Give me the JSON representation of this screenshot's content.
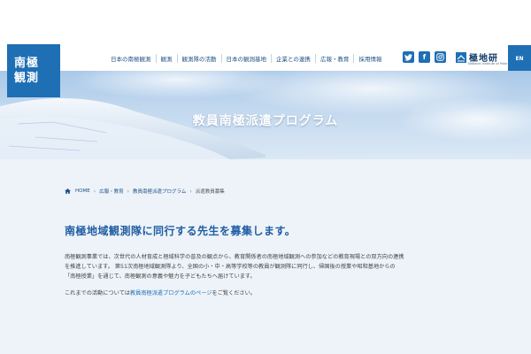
{
  "logo": {
    "line1": "南極",
    "line2": "観測"
  },
  "nav": {
    "items": [
      {
        "label": "日本の南極観測"
      },
      {
        "label": "観測"
      },
      {
        "label": "観測隊の活動"
      },
      {
        "label": "日本の観測基地"
      },
      {
        "label": "企業との連携"
      },
      {
        "label": "広報・教育"
      },
      {
        "label": "採用情報"
      }
    ]
  },
  "social": {
    "twitter": "twitter-icon",
    "facebook": "facebook-icon",
    "instagram": "instagram-icon"
  },
  "brand": {
    "name": "極地研",
    "sub": "National Institute of Polar Research"
  },
  "lang": {
    "label": "EN"
  },
  "hero": {
    "title": "教員南極派遣プログラム"
  },
  "breadcrumb": {
    "home": "HOME",
    "items": [
      "広報・教育",
      "教員南極派遣プログラム",
      "派遣教員募集"
    ]
  },
  "main": {
    "heading": "南極地域観測隊に同行する先生を募集します。",
    "paragraph1_lines": [
      "南極観測事業では、次世代の人材育成と極域科学の普及の観点から、教育関係者の南極地域観測への参加などの教育現場との双方向の連携",
      "を推進しています。 第51次南極地域観測隊より、全国の小・中・高等学校等の教員が観測隊に同行し、帰国後の授業や昭和基地からの",
      "「南極授業」を通じて、南極観測の意義や魅力を子どもたちへ届けています。"
    ],
    "paragraph2_pre": "これまでの活動については",
    "paragraph2_link": "教員南極派遣プログラムのページ",
    "paragraph2_post": "をご覧ください。"
  },
  "colors": {
    "accent": "#1f6fb4",
    "heading": "#1f5ea3",
    "background": "#edf3f8"
  }
}
